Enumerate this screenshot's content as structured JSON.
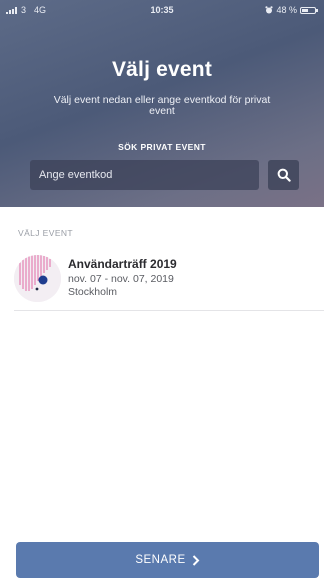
{
  "status_bar": {
    "carrier": "3",
    "network": "4G",
    "time": "10:35",
    "battery_percent": "48 %",
    "battery_level": 0.48
  },
  "header": {
    "title": "Välj event",
    "subtitle": "Välj event nedan eller ange eventkod för privat event"
  },
  "search": {
    "label": "SÖK PRIVAT EVENT",
    "placeholder": "Ange eventkod",
    "value": "",
    "button_icon": "search-icon"
  },
  "events_section": {
    "header": "VÄLJ EVENT",
    "items": [
      {
        "name": "Användarträff 2019",
        "dates": "nov. 07 - nov. 07, 2019",
        "location": "Stockholm",
        "logo_icon": "event-logo-icon"
      }
    ]
  },
  "footer": {
    "later_label": "SENARE",
    "later_icon": "chevron-right-icon",
    "accent_color": "#5a7aae"
  }
}
